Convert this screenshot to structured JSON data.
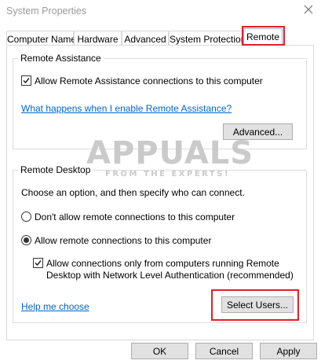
{
  "window": {
    "title": "System Properties"
  },
  "tabs": [
    {
      "label": "Computer Name"
    },
    {
      "label": "Hardware"
    },
    {
      "label": "Advanced"
    },
    {
      "label": "System Protection"
    },
    {
      "label": "Remote",
      "active": true
    }
  ],
  "remote_assistance": {
    "group_title": "Remote Assistance",
    "allow_label": "Allow Remote Assistance connections to this computer",
    "allow_checked": true,
    "help_link": "What happens when I enable Remote Assistance?",
    "advanced_button": "Advanced..."
  },
  "remote_desktop": {
    "group_title": "Remote Desktop",
    "instruction": "Choose an option, and then specify who can connect.",
    "options": [
      {
        "label": "Don't allow remote connections to this computer",
        "selected": false
      },
      {
        "label": "Allow remote connections to this computer",
        "selected": true
      }
    ],
    "nla_label_line1": "Allow connections only from computers running Remote",
    "nla_label_line2": "Desktop with Network Level Authentication (recommended)",
    "nla_checked": true,
    "help_link": "Help me choose",
    "select_users_button": "Select Users..."
  },
  "watermark": {
    "brand": "APPUALS",
    "tagline": "FROM THE EXPERTS!"
  },
  "footer": {
    "ok_button": "OK",
    "cancel_button": "Cancel",
    "apply_button": "Apply"
  },
  "colors": {
    "highlight": "#e01f26",
    "link": "#0066cc",
    "button_face": "#e1e1e1"
  }
}
